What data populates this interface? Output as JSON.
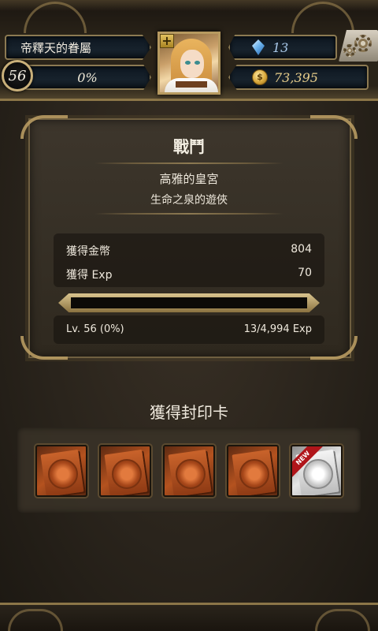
{
  "header": {
    "player_name": "帝釋天的眷屬",
    "level": "56",
    "exp_percent": "0%",
    "gems": "13",
    "gold": "73,395",
    "portrait_icon": "character-portrait",
    "plus_icon": "plus-icon",
    "gem_icon": "gem-icon",
    "coin_icon": "coin-icon",
    "settings_icon": "gears-icon"
  },
  "battle": {
    "title": "戰鬥",
    "stage": "高雅的皇宮",
    "quest": "生命之泉的遊俠",
    "rewards": [
      {
        "label": "獲得金幣",
        "value": "804"
      },
      {
        "label": "獲得 Exp",
        "value": "70"
      }
    ],
    "exp_bar_fill": 0.0,
    "level_text": "Lv. 56 (0%)",
    "exp_text": "13/4,994 Exp"
  },
  "cards": {
    "heading": "獲得封印卡",
    "items": [
      {
        "type": "bronze",
        "new": false
      },
      {
        "type": "bronze",
        "new": false
      },
      {
        "type": "bronze",
        "new": false
      },
      {
        "type": "bronze",
        "new": false
      },
      {
        "type": "silver",
        "new": true,
        "badge": "NEW"
      }
    ]
  },
  "colors": {
    "accent_gold": "#b89b62",
    "exp_green": "#5fbf3a",
    "new_badge": "#b0151a"
  }
}
